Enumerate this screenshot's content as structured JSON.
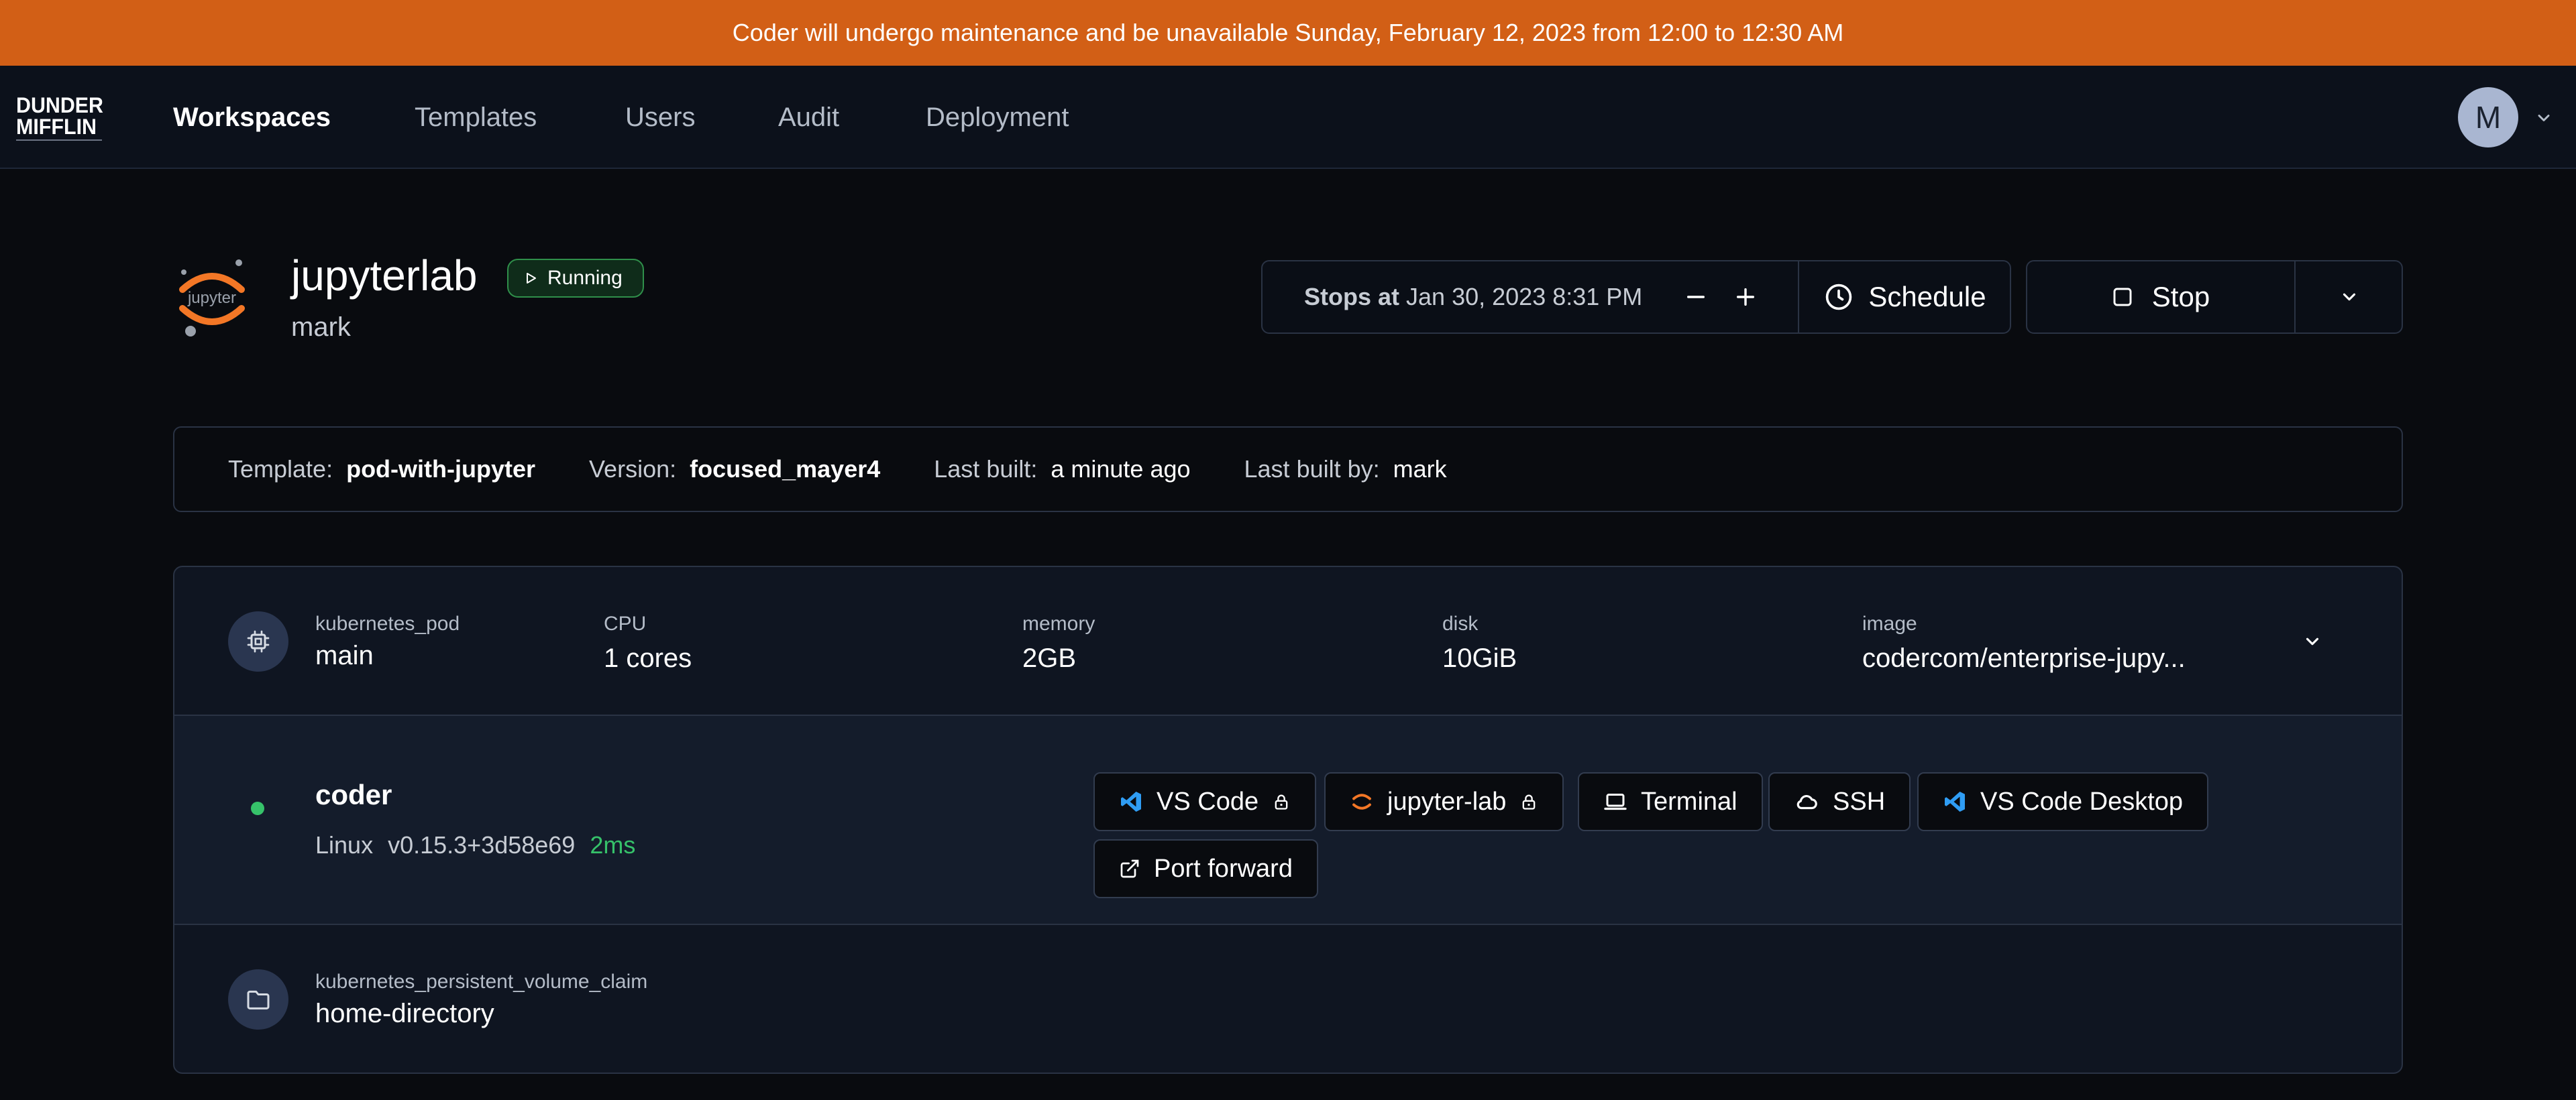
{
  "banner": {
    "text": "Coder will undergo maintenance and be unavailable Sunday, February 12, 2023 from 12:00 to 12:30 AM"
  },
  "logo": {
    "line1": "DUNDER",
    "line2": "MIFFLIN"
  },
  "nav": {
    "items": [
      {
        "label": "Workspaces",
        "active": true
      },
      {
        "label": "Templates"
      },
      {
        "label": "Users"
      },
      {
        "label": "Audit"
      },
      {
        "label": "Deployment"
      }
    ]
  },
  "user": {
    "initial": "M"
  },
  "workspace": {
    "icon_text": "jupyter",
    "name": "jupyterlab",
    "status": "Running",
    "owner": "mark"
  },
  "schedule": {
    "stops_label": "Stops at",
    "stops_time": "Jan 30, 2023 8:31 PM",
    "schedule_label": "Schedule"
  },
  "actions": {
    "stop_label": "Stop"
  },
  "stats": {
    "template_label": "Template:",
    "template_value": "pod-with-jupyter",
    "version_label": "Version:",
    "version_value": "focused_mayer4",
    "last_built_label": "Last built:",
    "last_built_value": "a minute ago",
    "last_built_by_label": "Last built by:",
    "last_built_by_value": "mark"
  },
  "resources": {
    "pod": {
      "type": "kubernetes_pod",
      "name": "main",
      "meta": [
        {
          "label": "CPU",
          "value": "1 cores"
        },
        {
          "label": "memory",
          "value": "2GB"
        },
        {
          "label": "disk",
          "value": "10GiB"
        },
        {
          "label": "image",
          "value": "codercom/enterprise-jupy..."
        }
      ]
    },
    "agent": {
      "name": "coder",
      "os": "Linux",
      "version": "v0.15.3+3d58e69",
      "latency": "2ms",
      "status_color": "#36c26a",
      "apps": [
        {
          "label": "VS Code",
          "icon": "vscode-icon",
          "locked": true
        },
        {
          "label": "jupyter-lab",
          "icon": "jupyter-icon",
          "locked": true
        },
        {
          "label": "Terminal",
          "icon": "terminal-icon"
        },
        {
          "label": "SSH",
          "icon": "cloud-icon"
        },
        {
          "label": "VS Code Desktop",
          "icon": "vscode-icon"
        },
        {
          "label": "Port forward",
          "icon": "external-link-icon"
        }
      ]
    },
    "pvc": {
      "type": "kubernetes_persistent_volume_claim",
      "name": "home-directory"
    }
  },
  "colors": {
    "banner": "#d25f16",
    "background": "#090b0f",
    "running_green": "#36c26a",
    "vscode_blue": "#2f9df4",
    "jupyter_orange": "#f37726"
  }
}
